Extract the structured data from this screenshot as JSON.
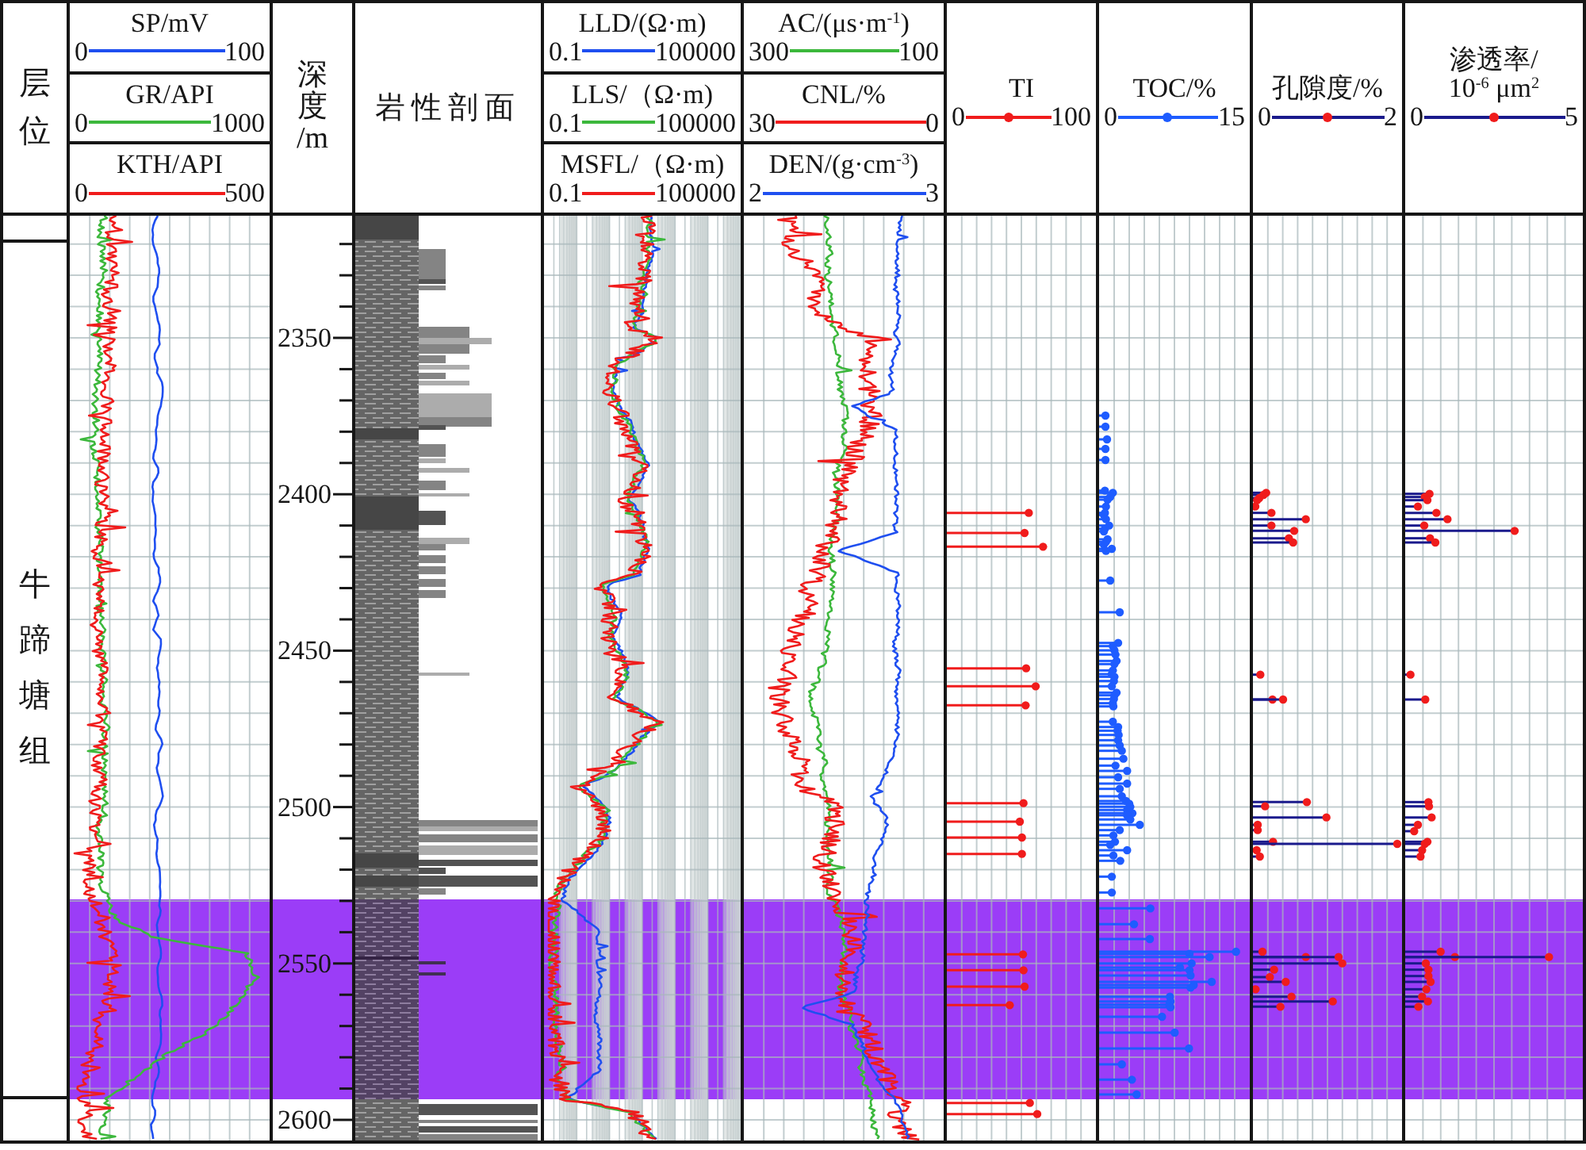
{
  "tracks": [
    {
      "kind": "formation",
      "header": "层位",
      "unit": "牛蹄塘组"
    },
    {
      "kind": "curves",
      "log_scale": false,
      "curves": [
        {
          "name": "SP/mV",
          "min": "0",
          "max": "100",
          "color": "#1f4ff0"
        },
        {
          "name": "GR/API",
          "min": "0",
          "max": "1000",
          "color": "#3cb83c"
        },
        {
          "name": "KTH/API",
          "min": "0",
          "max": "500",
          "color": "#f01c1c"
        }
      ]
    },
    {
      "kind": "depth",
      "header": "深度/m",
      "labels": [
        "2350",
        "2400",
        "2450",
        "2500",
        "2550",
        "2600"
      ]
    },
    {
      "kind": "lithology",
      "header": "岩性剖面"
    },
    {
      "kind": "curves",
      "log_scale": true,
      "curves": [
        {
          "name": "LLD/(Ω·m)",
          "min": "0.1",
          "max": "100000",
          "color": "#1f4ff0"
        },
        {
          "name": "LLS/（Ω·m)",
          "min": "0.1",
          "max": "100000",
          "color": "#3cb83c"
        },
        {
          "name": "MSFL/（Ω·m)",
          "min": "0.1",
          "max": "100000",
          "color": "#f01c1c"
        }
      ]
    },
    {
      "kind": "curves",
      "log_scale": false,
      "curves": [
        {
          "name": "AC/(μs·m$^{-1}$)",
          "min": "300",
          "max": "100",
          "color": "#3cb83c"
        },
        {
          "name": "CNL/%",
          "min": "30",
          "max": "0",
          "color": "#f01c1c"
        },
        {
          "name": "DEN/(g·cm$^{-3}$)",
          "min": "2",
          "max": "3",
          "color": "#1f4ff0"
        }
      ]
    },
    {
      "kind": "points",
      "title": [
        "TI"
      ],
      "min": "0",
      "max": "100",
      "color": "#f01c1c",
      "dot": {
        "color": "#f01c1c"
      }
    },
    {
      "kind": "points",
      "title": [
        "TOC/%"
      ],
      "min": "0",
      "max": "15",
      "color": "#1e5cff",
      "dot": {
        "color": "#1e5cff"
      }
    },
    {
      "kind": "points",
      "title": [
        "孔隙度/%"
      ],
      "min": "0",
      "max": "2",
      "color": "#1a1a8c",
      "dot": {
        "color": "#f01c1c"
      }
    },
    {
      "kind": "points",
      "title": [
        "渗透率/",
        "10$^{-6}$ μm$^{2}$"
      ],
      "min": "0",
      "max": "5",
      "color": "#1a1a8c",
      "dot": {
        "color": "#f01c1c"
      }
    }
  ]
}
